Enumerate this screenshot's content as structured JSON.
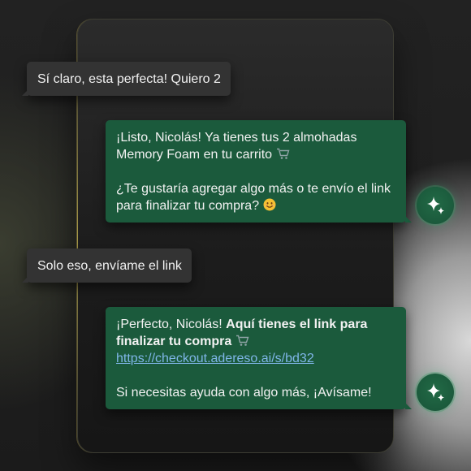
{
  "messages": [
    {
      "role": "user",
      "text": "Sí claro, esta perfecta! Quiero 2"
    },
    {
      "role": "assistant",
      "line1": "¡Listo, Nicolás! Ya tienes tus 2 almohadas",
      "line2": "Memory Foam en tu carrito",
      "line3": "¿Te gustaría agregar algo más o te envío el link",
      "line4": "para finalizar tu compra?",
      "icon_cart": "shopping-cart-emoji",
      "icon_smile": "smiling-face-emoji"
    },
    {
      "role": "user",
      "text": "Solo eso, envíame el link"
    },
    {
      "role": "assistant",
      "intro": "¡Perfecto, Nicolás!",
      "bold1": "Aquí tienes el link para",
      "bold2": "finalizar tu compra",
      "link": "https://checkout.adereso.ai/s/bd32",
      "footer": "Si necesitas ayuda con algo más, ¡Avísame!",
      "icon_cart": "shopping-cart-emoji"
    }
  ],
  "bot_avatar_icon": "sparkles-icon",
  "colors": {
    "bot_bubble": "#1b5a3c",
    "user_bubble": "#333333",
    "link": "#7fb6e8"
  }
}
